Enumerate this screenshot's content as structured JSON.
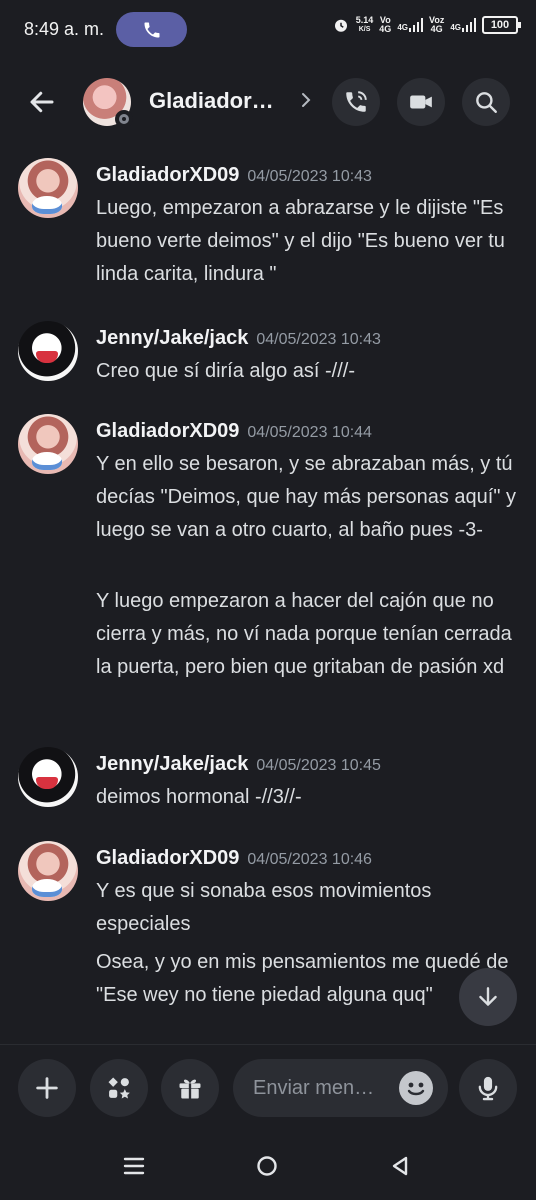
{
  "status_bar": {
    "time": "8:49 a. m.",
    "speed_value": "5.14",
    "speed_unit": "K/S",
    "sim1_top": "Vo",
    "sim1_bottom": "4G",
    "net1": "4G",
    "sim2_top": "Voz",
    "sim2_bottom": "4G",
    "net2": "4G",
    "battery": "100"
  },
  "header": {
    "title": "Gladiador…",
    "icons": [
      "back-arrow",
      "chevron-right",
      "voice-call",
      "video-call",
      "search"
    ]
  },
  "messages": [
    {
      "author": "GladiadorXD09",
      "timestamp": "04/05/2023 10:43",
      "lines": [
        "Luego, empezaron a abrazarse y le dijiste \"Es bueno verte deimos\" y el dijo \"Es bueno ver tu linda carita, lindura \""
      ]
    },
    {
      "author": "Jenny/Jake/jack",
      "timestamp": "04/05/2023 10:43",
      "lines": [
        "Creo que sí diría algo así -///-"
      ]
    },
    {
      "author": "GladiadorXD09",
      "timestamp": "04/05/2023 10:44",
      "lines": [
        "Y en ello se besaron, y se abrazaban más, y tú decías \"Deimos, que hay más personas aquí\" y luego se van a otro cuarto, al baño pues -3-",
        "Y luego empezaron a hacer del cajón que no cierra y más, no ví nada porque tenían cerrada la puerta, pero bien que gritaban de pasión xd"
      ]
    },
    {
      "author": "Jenny/Jake/jack",
      "timestamp": "04/05/2023 10:45",
      "lines": [
        "deimos hormonal -//3//-"
      ]
    },
    {
      "author": "GladiadorXD09",
      "timestamp": "04/05/2023 10:46",
      "lines": [
        "Y es que si sonaba esos movimientos especiales",
        "Osea, y yo en mis pensamientos me quedé de \"Ese wey no tiene piedad alguna quq\""
      ]
    }
  ],
  "composer": {
    "placeholder": "Enviar men…",
    "icons": [
      "plus",
      "apps",
      "gift",
      "emoji",
      "microphone"
    ]
  },
  "colors": {
    "background": "#1c1d22",
    "button_bg": "#2b2d33",
    "call_pill": "#5b5fa5",
    "timestamp": "#949ba4"
  }
}
